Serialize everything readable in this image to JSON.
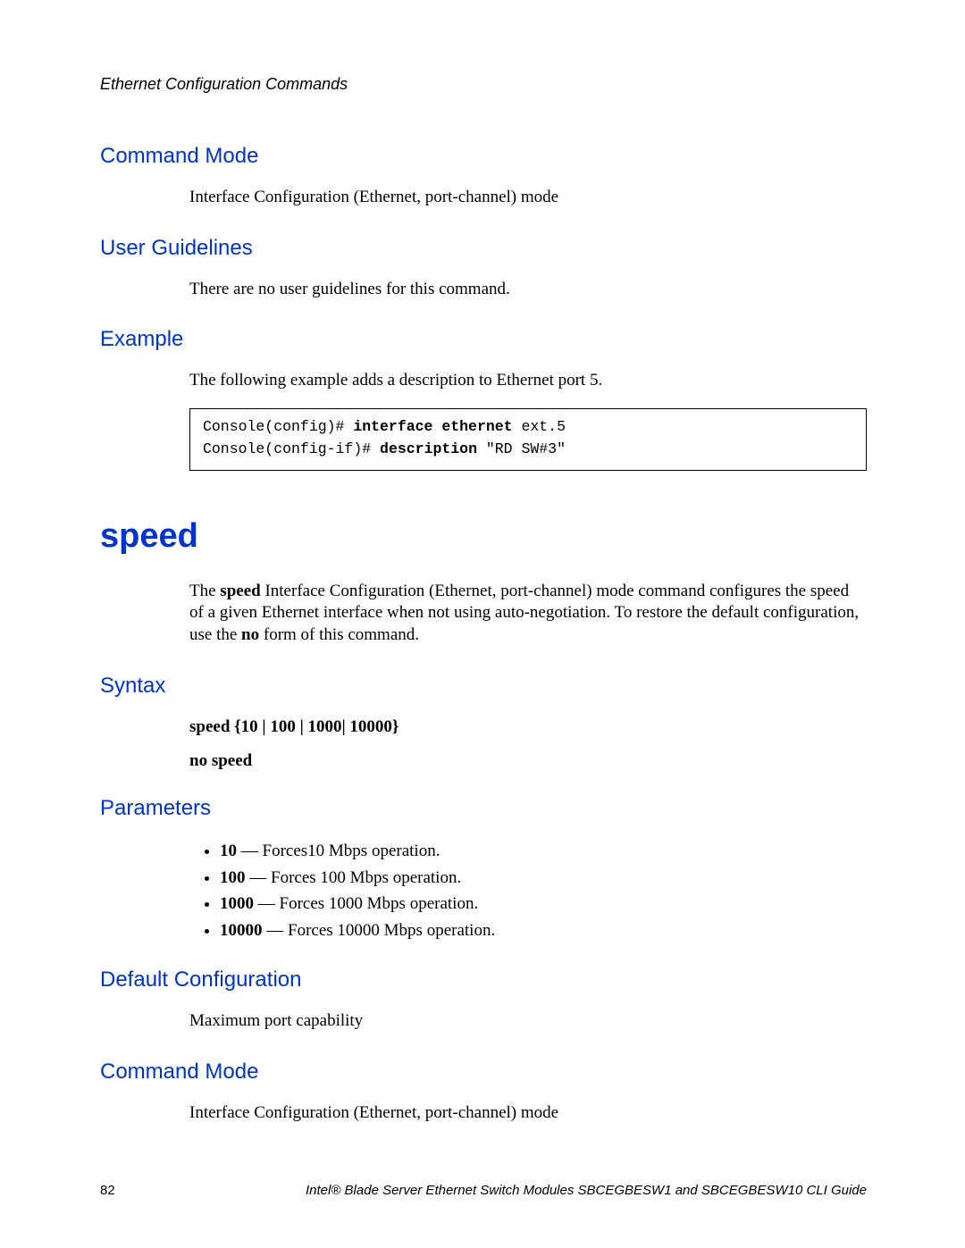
{
  "header": {
    "chapter": "Ethernet Configuration Commands"
  },
  "sections": {
    "cmd_mode_1": {
      "title": "Command Mode",
      "text": "Interface Configuration (Ethernet, port-channel) mode"
    },
    "user_guidelines": {
      "title": "User Guidelines",
      "text": "There are no user guidelines for this command."
    },
    "example": {
      "title": "Example",
      "intro": "The following example adds a description to Ethernet port 5.",
      "code": {
        "line1_prompt": "Console(config)# ",
        "line1_bold": "interface ethernet",
        "line1_arg": " ext.5",
        "line2_prompt": "Console(config-if)# ",
        "line2_bold": "description",
        "line2_arg": " \"RD SW#3\""
      }
    },
    "speed": {
      "title": "speed",
      "desc_pre": "The ",
      "desc_bold1": "speed",
      "desc_mid": " Interface Configuration (Ethernet, port-channel) mode command configures the speed of a given Ethernet interface when not using auto-negotiation. To restore the default configuration, use the ",
      "desc_bold2": "no",
      "desc_post": " form of this command."
    },
    "syntax": {
      "title": "Syntax",
      "line1": "speed {10 | 100 | 1000| 10000}",
      "line2": "no speed"
    },
    "parameters": {
      "title": "Parameters",
      "items": [
        {
          "key": "10",
          "desc": " — Forces10 Mbps operation."
        },
        {
          "key": "100",
          "desc": " — Forces 100 Mbps operation."
        },
        {
          "key": "1000",
          "desc": " — Forces 1000 Mbps operation."
        },
        {
          "key": "10000",
          "desc": " — Forces 10000 Mbps operation."
        }
      ]
    },
    "default_config": {
      "title": "Default Configuration",
      "text": "Maximum port capability"
    },
    "cmd_mode_2": {
      "title": "Command Mode",
      "text": "Interface Configuration (Ethernet, port-channel) mode"
    }
  },
  "footer": {
    "page": "82",
    "title": "Intel® Blade Server Ethernet Switch Modules SBCEGBESW1 and SBCEGBESW10 CLI Guide"
  }
}
